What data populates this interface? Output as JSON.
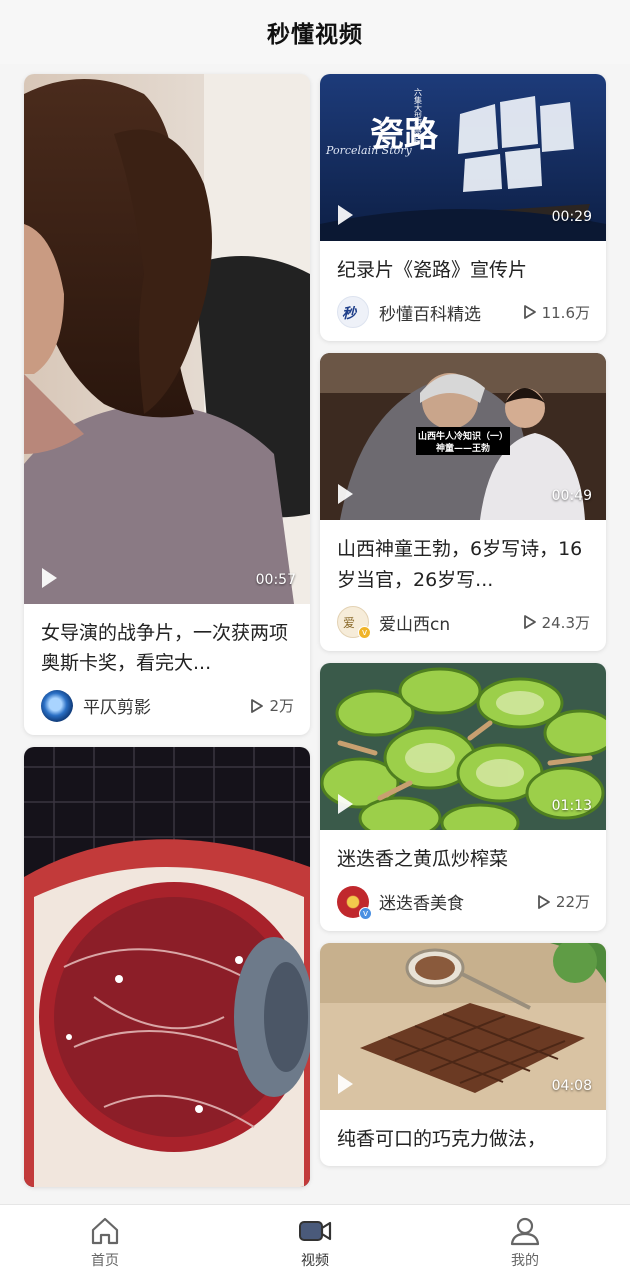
{
  "app": {
    "title": "秒懂视频"
  },
  "feed": {
    "left": [
      {
        "duration": "00:57",
        "title": "女导演的战争片，一次获两项奥斯卡奖，看完大...",
        "author": "平仄剪影",
        "views": "2万"
      },
      {
        "duration": "",
        "title": "",
        "author": "",
        "views": ""
      }
    ],
    "right": [
      {
        "duration": "00:29",
        "title": "纪录片《瓷路》宣传片",
        "author": "秒懂百科精选",
        "views": "11.6万",
        "thumb_text": {
          "big": "瓷路",
          "sub": "六集大型纪录片",
          "script": "Porcelain Story"
        }
      },
      {
        "duration": "00:49",
        "title": "山西神童王勃，6岁写诗，16岁当官，26岁写...",
        "author": "爱山西cn",
        "views": "24.3万",
        "verified": true,
        "thumb_text": {
          "line1": "山西牛人冷知识（一）",
          "line2": "神童——王勃"
        }
      },
      {
        "duration": "01:13",
        "title": "迷迭香之黄瓜炒榨菜",
        "author": "迷迭香美食",
        "views": "22万",
        "verified": true
      },
      {
        "duration": "04:08",
        "title": "纯香可口的巧克力做法，",
        "author": "",
        "views": ""
      }
    ]
  },
  "tabbar": {
    "items": [
      {
        "label": "首页",
        "icon": "home-icon"
      },
      {
        "label": "视频",
        "icon": "video-icon",
        "active": true
      },
      {
        "label": "我的",
        "icon": "user-icon"
      }
    ]
  },
  "colors": {
    "accent": "#333333",
    "verified_badge": "#4a90e2",
    "background": "#f5f5f5"
  }
}
